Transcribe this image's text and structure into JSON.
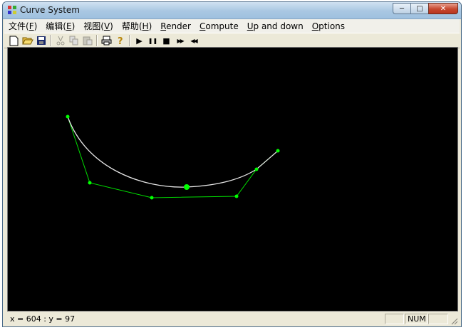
{
  "window": {
    "title": "Curve System",
    "icon": "app-icon",
    "buttons": {
      "minimize": "─",
      "maximize": "□",
      "close": "✕"
    }
  },
  "menu": [
    {
      "label": "文件(",
      "key": "F",
      "tail": ")"
    },
    {
      "label": "编辑(",
      "key": "E",
      "tail": ")"
    },
    {
      "label": "视图(",
      "key": "V",
      "tail": ")"
    },
    {
      "label": "帮助(",
      "key": "H",
      "tail": ")"
    },
    {
      "label": "",
      "key": "R",
      "tail": "ender"
    },
    {
      "label": "",
      "key": "C",
      "tail": "ompute"
    },
    {
      "label": "",
      "key": "U",
      "tail": "p and down"
    },
    {
      "label": "",
      "key": "O",
      "tail": "ptions"
    }
  ],
  "toolbar": {
    "new": "new-file-icon",
    "open": "open-folder-icon",
    "save": "save-disk-icon",
    "cut": "cut-icon",
    "copy": "copy-icon",
    "paste": "paste-icon",
    "print": "print-icon",
    "help": "help-icon",
    "play": "▶",
    "pause": "❚❚",
    "stop": "■",
    "forward": "▶▶",
    "rewind": "◀◀"
  },
  "canvas": {
    "background": "#000000",
    "control_color": "#00dd00",
    "curve_color": "#e0e0e0"
  },
  "status": {
    "text": "x = 604 : y = 97",
    "pane1": "",
    "pane2": "NUM",
    "pane3": ""
  }
}
